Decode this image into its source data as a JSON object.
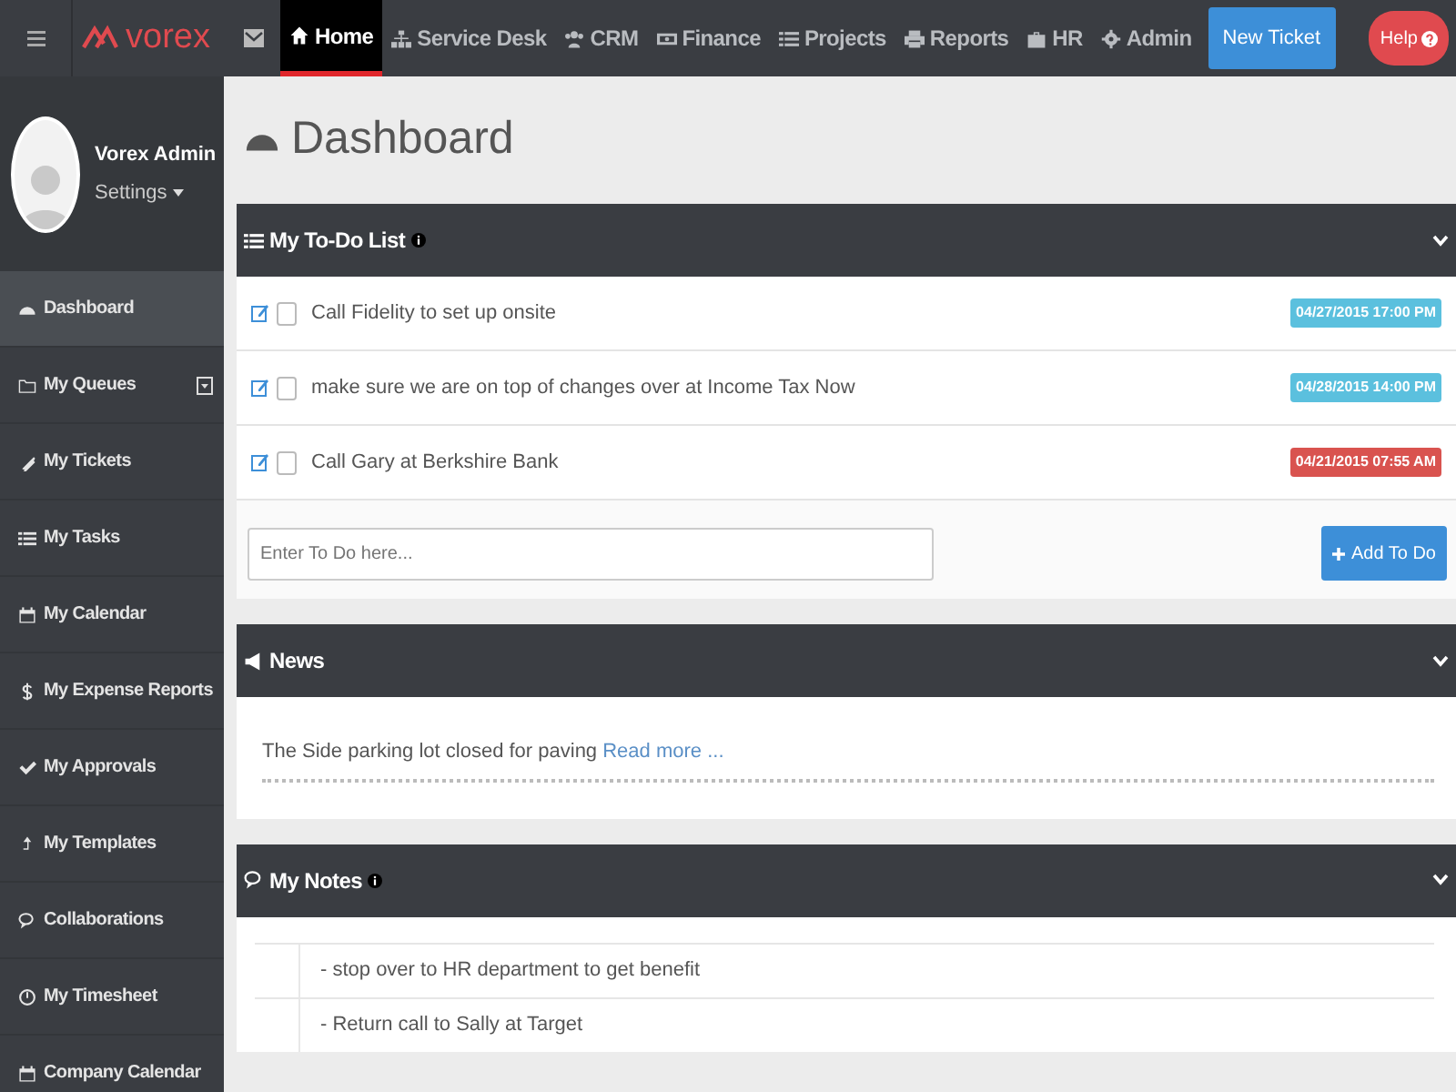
{
  "navbar": {
    "logo": "vorex",
    "items": [
      {
        "label": "Home",
        "selected": true
      },
      {
        "label": "Service Desk",
        "selected": false
      },
      {
        "label": "CRM",
        "selected": false
      },
      {
        "label": "Finance",
        "selected": false
      },
      {
        "label": "Projects",
        "selected": false
      },
      {
        "label": "Reports",
        "selected": false
      },
      {
        "label": "HR",
        "selected": false
      },
      {
        "label": "Admin",
        "selected": false
      }
    ],
    "new_ticket": "New Ticket",
    "help": "Help"
  },
  "profile": {
    "name": "Vorex Admin",
    "settings": "Settings"
  },
  "sidebar": {
    "items": [
      {
        "label": "Dashboard",
        "kind": "link",
        "selected": true
      },
      {
        "label": "My Queues",
        "kind": "expandable",
        "selected": false
      },
      {
        "label": "My Tickets",
        "kind": "link",
        "selected": false
      },
      {
        "label": "My Tasks",
        "kind": "link",
        "selected": false
      },
      {
        "label": "My Calendar",
        "kind": "link",
        "selected": false
      },
      {
        "label": "My Expense Reports",
        "kind": "link",
        "selected": false
      },
      {
        "label": "My Approvals",
        "kind": "link",
        "selected": false
      },
      {
        "label": "My Templates",
        "kind": "link",
        "selected": false
      },
      {
        "label": "Collaborations",
        "kind": "link",
        "selected": false
      },
      {
        "label": "My Timesheet",
        "kind": "link",
        "selected": false
      },
      {
        "label": "Company Calendar",
        "kind": "link",
        "selected": false
      }
    ]
  },
  "page_title": "Dashboard",
  "todo": {
    "title": "My To-Do List",
    "items": [
      {
        "text": "Call Fidelity to set up onsite",
        "checked": false,
        "due": "04/27/2015 17:00 PM",
        "color": "#5bc0de"
      },
      {
        "text": "make sure we are on top of changes over at Income Tax Now",
        "checked": false,
        "due": "04/28/2015 14:00 PM",
        "color": "#5bc0de"
      },
      {
        "text": "Call Gary at Berkshire Bank",
        "checked": false,
        "due": "04/21/2015 07:55 AM",
        "color": "#d9534f"
      }
    ],
    "input": {
      "placeholder": "Enter To Do here..."
    },
    "add_button": "Add To Do"
  },
  "news": {
    "title": "News",
    "items": [
      {
        "text": "The Side parking lot closed for paving",
        "link": "Read more ..."
      }
    ]
  },
  "notes": {
    "title": "My Notes",
    "items": [
      "- stop over to HR department to get benefit",
      "- Return call to Sally at Target"
    ]
  }
}
